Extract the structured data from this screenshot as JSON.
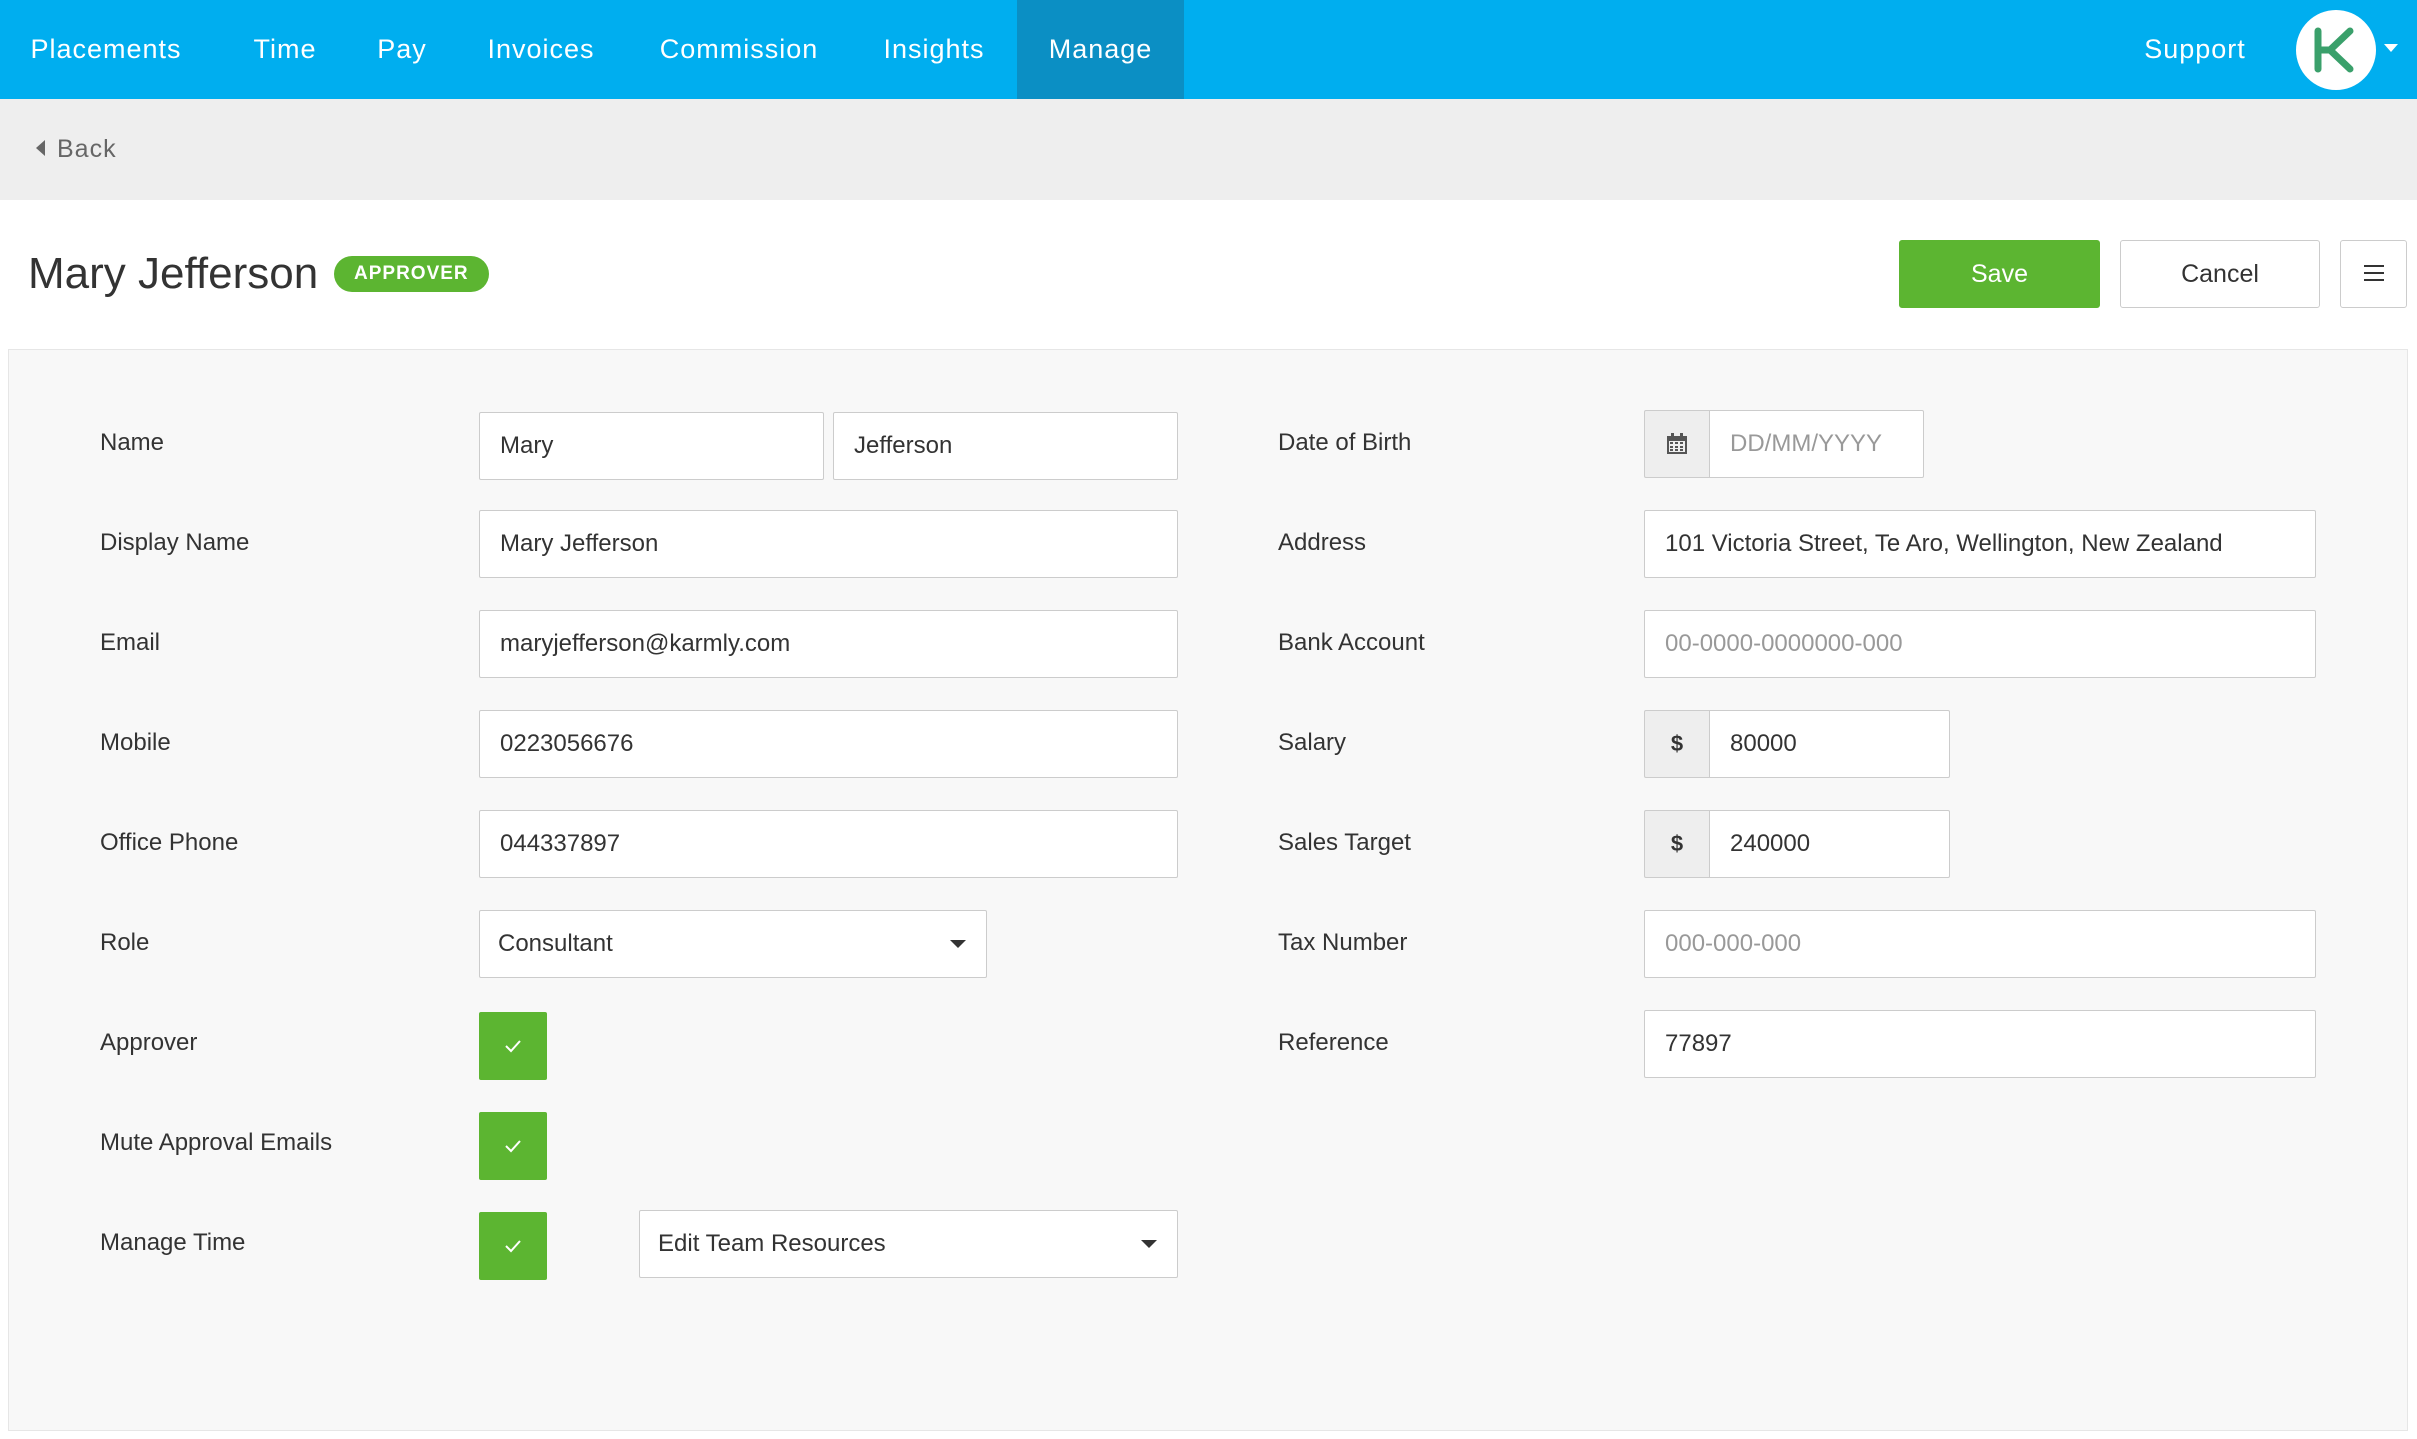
{
  "nav": {
    "items": [
      {
        "label": "Placements"
      },
      {
        "label": "Time"
      },
      {
        "label": "Pay"
      },
      {
        "label": "Invoices"
      },
      {
        "label": "Commission"
      },
      {
        "label": "Insights"
      },
      {
        "label": "Manage",
        "active": true
      }
    ],
    "support_label": "Support",
    "brand_color": "#00aeef",
    "active_color": "#0b8fc4"
  },
  "backbar": {
    "back_label": "Back"
  },
  "header": {
    "title": "Mary Jefferson",
    "badge": "APPROVER",
    "save_label": "Save",
    "cancel_label": "Cancel"
  },
  "form": {
    "left": {
      "name_label": "Name",
      "first_name": "Mary",
      "last_name": "Jefferson",
      "display_name_label": "Display Name",
      "display_name": "Mary Jefferson",
      "email_label": "Email",
      "email": "maryjefferson@karmly.com",
      "mobile_label": "Mobile",
      "mobile": "0223056676",
      "office_phone_label": "Office Phone",
      "office_phone": "044337897",
      "role_label": "Role",
      "role_value": "Consultant",
      "approver_label": "Approver",
      "approver_checked": true,
      "mute_label": "Mute Approval Emails",
      "mute_checked": true,
      "manage_time_label": "Manage Time",
      "manage_time_checked": true,
      "manage_time_value": "Edit Team Resources"
    },
    "right": {
      "dob_label": "Date of Birth",
      "dob_placeholder": "DD/MM/YYYY",
      "address_label": "Address",
      "address": "101 Victoria Street, Te Aro, Wellington, New Zealand",
      "bank_label": "Bank Account",
      "bank_placeholder": "00-0000-0000000-000",
      "salary_label": "Salary",
      "currency_symbol": "$",
      "salary": "80000",
      "sales_target_label": "Sales Target",
      "sales_target": "240000",
      "tax_label": "Tax Number",
      "tax_placeholder": "000-000-000",
      "reference_label": "Reference",
      "reference": "77897"
    }
  },
  "colors": {
    "accent_green": "#5cb531",
    "panel_bg": "#f8f8f8"
  }
}
